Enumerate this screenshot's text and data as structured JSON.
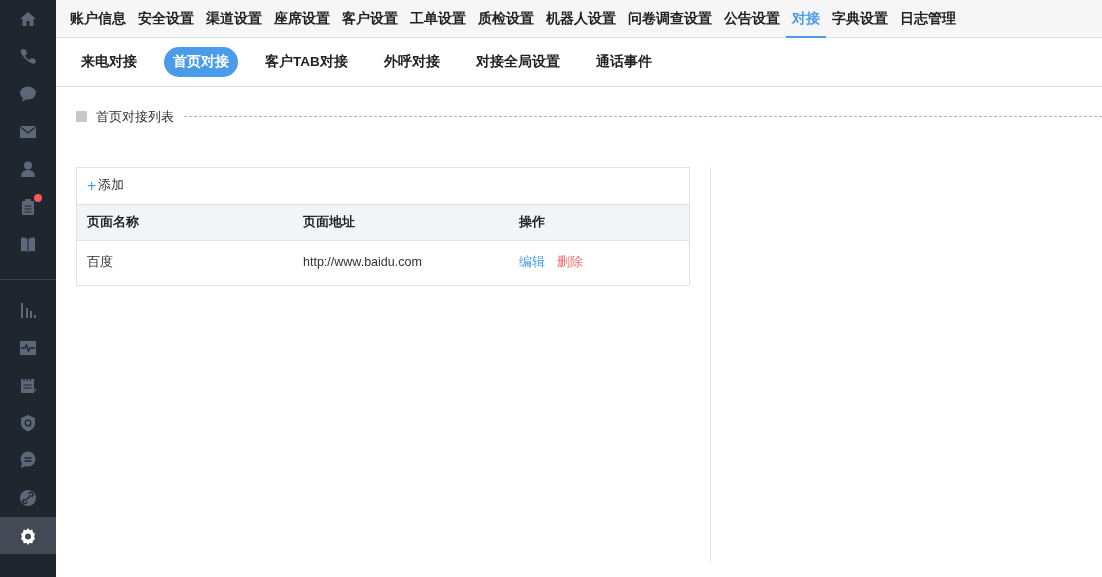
{
  "sidebar": {
    "groups": [
      [
        {
          "selected": false,
          "has_badge": false
        },
        {
          "selected": false,
          "has_badge": false
        },
        {
          "selected": false,
          "has_badge": false
        },
        {
          "selected": false,
          "has_badge": false
        },
        {
          "selected": false,
          "has_badge": false
        },
        {
          "selected": false,
          "has_badge": true
        },
        {
          "selected": false,
          "has_badge": false
        }
      ],
      [
        {
          "selected": false,
          "has_badge": false
        },
        {
          "selected": false,
          "has_badge": false
        },
        {
          "selected": false,
          "has_badge": false
        },
        {
          "selected": false,
          "has_badge": false
        },
        {
          "selected": false,
          "has_badge": false
        },
        {
          "selected": false,
          "has_badge": false
        },
        {
          "selected": true,
          "has_badge": false
        }
      ]
    ]
  },
  "top_tabs": [
    {
      "label": "账户信息",
      "selected": false
    },
    {
      "label": "安全设置",
      "selected": false
    },
    {
      "label": "渠道设置",
      "selected": false
    },
    {
      "label": "座席设置",
      "selected": false
    },
    {
      "label": "客户设置",
      "selected": false
    },
    {
      "label": "工单设置",
      "selected": false
    },
    {
      "label": "质检设置",
      "selected": false
    },
    {
      "label": "机器人设置",
      "selected": false
    },
    {
      "label": "问卷调查设置",
      "selected": false
    },
    {
      "label": "公告设置",
      "selected": false
    },
    {
      "label": "对接",
      "selected": true
    },
    {
      "label": "字典设置",
      "selected": false
    },
    {
      "label": "日志管理",
      "selected": false
    }
  ],
  "sub_tabs": [
    {
      "label": "来电对接",
      "selected": false
    },
    {
      "label": "首页对接",
      "selected": true
    },
    {
      "label": "客户TAB对接",
      "selected": false
    },
    {
      "label": "外呼对接",
      "selected": false
    },
    {
      "label": "对接全局设置",
      "selected": false
    },
    {
      "label": "通话事件",
      "selected": false
    }
  ],
  "section_title": "首页对接列表",
  "add_button": {
    "icon": "+",
    "label": "添加"
  },
  "table": {
    "columns": [
      "页面名称",
      "页面地址",
      "操作"
    ],
    "rows": [
      {
        "name": "百度",
        "url": "http://www.baidu.com",
        "actions": [
          {
            "label": "编辑",
            "kind": "edit"
          },
          {
            "label": "删除",
            "kind": "delete"
          }
        ]
      }
    ]
  }
}
